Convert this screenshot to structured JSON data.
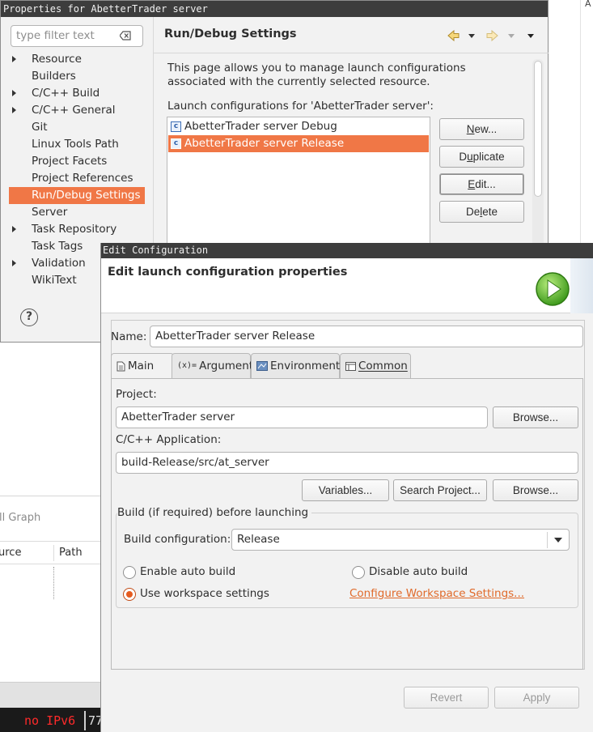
{
  "background": {
    "graph_label": "ll Graph",
    "col_source": "urce",
    "col_path": "Path",
    "terminal_text": "no IPv6",
    "terminal_text2": "77",
    "right_letter": "A"
  },
  "properties": {
    "title": "Properties for AbetterTrader server",
    "filter_placeholder": "type filter text",
    "tree": [
      {
        "label": "Resource",
        "expandable": true
      },
      {
        "label": "Builders",
        "expandable": false
      },
      {
        "label": "C/C++ Build",
        "expandable": true
      },
      {
        "label": "C/C++ General",
        "expandable": true
      },
      {
        "label": "Git",
        "expandable": false
      },
      {
        "label": "Linux Tools Path",
        "expandable": false
      },
      {
        "label": "Project Facets",
        "expandable": false
      },
      {
        "label": "Project References",
        "expandable": false
      },
      {
        "label": "Run/Debug Settings",
        "expandable": false,
        "selected": true
      },
      {
        "label": "Server",
        "expandable": false
      },
      {
        "label": "Task Repository",
        "expandable": true
      },
      {
        "label": "Task Tags",
        "expandable": false
      },
      {
        "label": "Validation",
        "expandable": true
      },
      {
        "label": "WikiText",
        "expandable": false
      }
    ],
    "help_glyph": "?",
    "page_title": "Run/Debug Settings",
    "description": "This page allows you to manage launch configurations associated with the currently selected resource.",
    "launch_label": "Launch configurations for 'AbetterTrader server':",
    "launch_configs": [
      {
        "label": "AbetterTrader server Debug",
        "selected": false
      },
      {
        "label": "AbetterTrader server Release",
        "selected": true
      }
    ],
    "buttons": {
      "new": "New...",
      "duplicate": "Duplicate",
      "edit": "Edit...",
      "delete": "Delete"
    }
  },
  "edit_config": {
    "title": "Edit Configuration",
    "header": "Edit launch configuration properties",
    "name_label": "Name:",
    "name_value": "AbetterTrader server Release",
    "tabs": [
      {
        "label": "Main",
        "icon": "document-icon",
        "active": true
      },
      {
        "label": "Arguments",
        "icon": "arguments-icon",
        "active": false
      },
      {
        "label": "Environment",
        "icon": "environment-icon",
        "active": false
      },
      {
        "label": "Common",
        "icon": "common-icon",
        "active": false
      }
    ],
    "project_label": "Project:",
    "project_value": "AbetterTrader server",
    "browse": "Browse...",
    "app_label": "C/C++ Application:",
    "app_value": "build-Release/src/at_server",
    "variables": "Variables...",
    "search_project": "Search Project...",
    "build_group_label": "Build (if required) before launching",
    "build_config_label": "Build configuration:",
    "build_config_value": "Release",
    "enable_auto_build": "Enable auto build",
    "disable_auto_build": "Disable auto build",
    "use_workspace": "Use workspace settings",
    "configure_link": "Configure Workspace Settings...",
    "revert": "Revert",
    "apply": "Apply",
    "accent_color": "#f07746",
    "link_color": "#e06a2a"
  }
}
